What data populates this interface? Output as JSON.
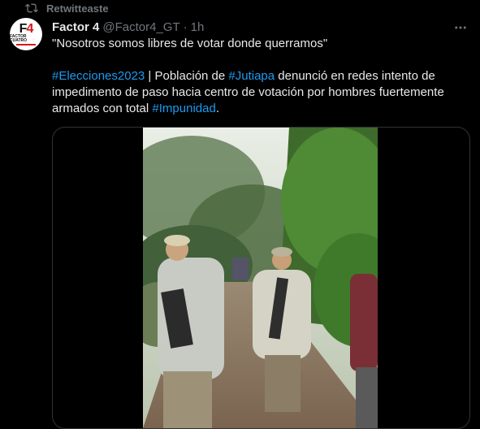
{
  "retweet": {
    "label": "Retwitteaste"
  },
  "avatar": {
    "logo_top": "F",
    "logo_num": "4",
    "logo_sub": "FACTOR CUATRO"
  },
  "author": {
    "name": "Factor 4",
    "handle": "@Factor4_GT",
    "dot": "·",
    "time": "1h"
  },
  "tweet": {
    "line1": "\"Nosotros somos libres de votar donde querramos\"",
    "hashtag1": "#Elecciones2023",
    "seg1": " |  Población de ",
    "hashtag2": "#Jutiapa",
    "seg2": " denunció en redes intento de impedimento de paso hacia centro de votación por hombres fuertemente armados con total ",
    "hashtag3": "#Impunidad",
    "seg3": "."
  },
  "icons": {
    "retweet": "retweet-icon",
    "more": "more-icon",
    "verified": "none"
  },
  "colors": {
    "accent": "#1d9bf0",
    "text": "#e7e9ea",
    "muted": "#71767b",
    "border": "#2f3336",
    "brand": "#d5171d"
  }
}
